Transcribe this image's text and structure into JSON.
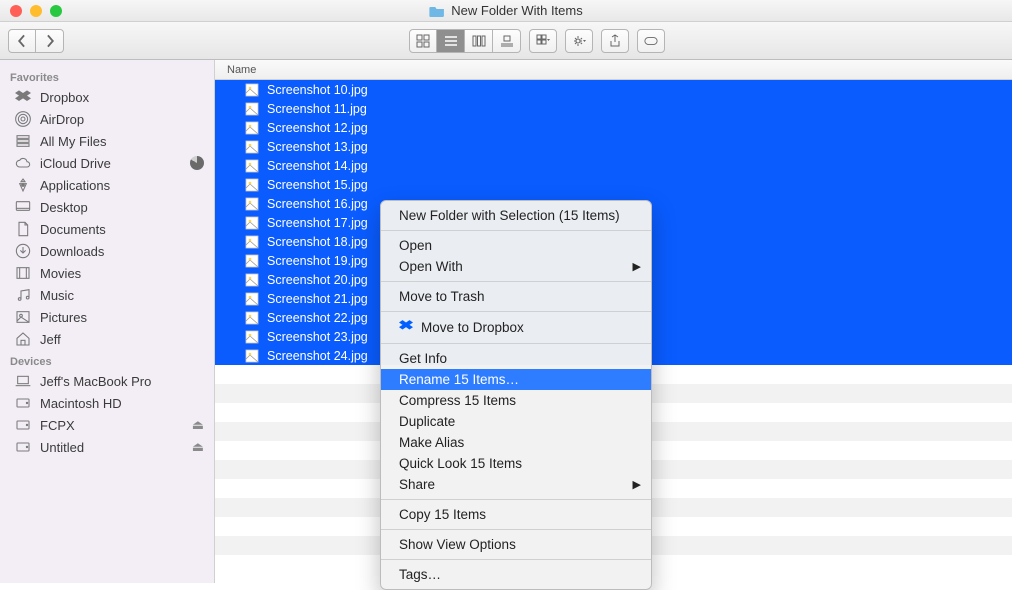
{
  "window": {
    "title": "New Folder With Items"
  },
  "toolbar": {
    "back": "‹",
    "forward": "›",
    "viewmodes": [
      "icon",
      "list",
      "column",
      "coverflow"
    ],
    "active_view": "list"
  },
  "sidebar": {
    "sections": [
      {
        "heading": "Favorites",
        "items": [
          {
            "icon": "dropbox",
            "label": "Dropbox"
          },
          {
            "icon": "airdrop",
            "label": "AirDrop"
          },
          {
            "icon": "allfiles",
            "label": "All My Files"
          },
          {
            "icon": "icloud",
            "label": "iCloud Drive",
            "badge": "pie"
          },
          {
            "icon": "apps",
            "label": "Applications"
          },
          {
            "icon": "desktop",
            "label": "Desktop"
          },
          {
            "icon": "documents",
            "label": "Documents"
          },
          {
            "icon": "downloads",
            "label": "Downloads"
          },
          {
            "icon": "movies",
            "label": "Movies"
          },
          {
            "icon": "music",
            "label": "Music"
          },
          {
            "icon": "pictures",
            "label": "Pictures"
          },
          {
            "icon": "home",
            "label": "Jeff"
          }
        ]
      },
      {
        "heading": "Devices",
        "items": [
          {
            "icon": "laptop",
            "label": "Jeff's MacBook Pro"
          },
          {
            "icon": "hdd",
            "label": "Macintosh HD"
          },
          {
            "icon": "hdd",
            "label": "FCPX",
            "eject": true
          },
          {
            "icon": "hdd",
            "label": "Untitled",
            "eject": true
          }
        ]
      }
    ]
  },
  "filelist": {
    "column": "Name",
    "files": [
      "Screenshot 10.jpg",
      "Screenshot 11.jpg",
      "Screenshot 12.jpg",
      "Screenshot 13.jpg",
      "Screenshot 14.jpg",
      "Screenshot 15.jpg",
      "Screenshot 16.jpg",
      "Screenshot 17.jpg",
      "Screenshot 18.jpg",
      "Screenshot 19.jpg",
      "Screenshot 20.jpg",
      "Screenshot 21.jpg",
      "Screenshot 22.jpg",
      "Screenshot 23.jpg",
      "Screenshot 24.jpg"
    ],
    "emptyrows": 11
  },
  "contextmenu": {
    "highlighted": "Rename 15 Items…",
    "groups": [
      [
        "New Folder with Selection (15 Items)"
      ],
      [
        "Open",
        {
          "label": "Open With",
          "submenu": true
        }
      ],
      [
        "Move to Trash"
      ],
      [
        {
          "label": "Move to Dropbox",
          "icon": "dropbox"
        }
      ],
      [
        "Get Info",
        "Rename 15 Items…",
        "Compress 15 Items",
        "Duplicate",
        "Make Alias",
        "Quick Look 15 Items",
        {
          "label": "Share",
          "submenu": true
        }
      ],
      [
        "Copy 15 Items"
      ],
      [
        "Show View Options"
      ],
      [
        "Tags…"
      ]
    ]
  }
}
